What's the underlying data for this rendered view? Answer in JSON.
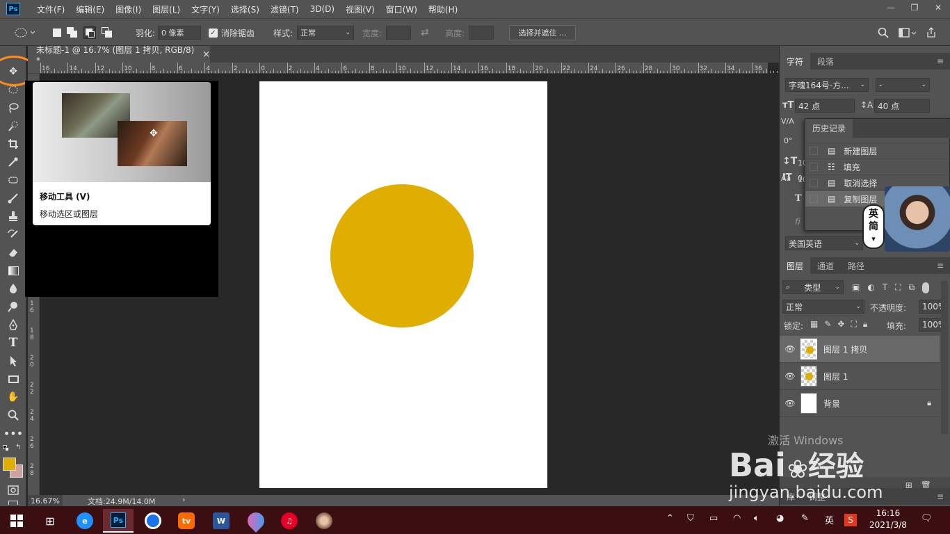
{
  "menu": {
    "items": [
      "文件(F)",
      "编辑(E)",
      "图像(I)",
      "图层(L)",
      "文字(Y)",
      "选择(S)",
      "滤镜(T)",
      "3D(D)",
      "视图(V)",
      "窗口(W)",
      "帮助(H)"
    ]
  },
  "app_logo": "Ps",
  "window_controls": {
    "minimize": "—",
    "restore": "❐",
    "close": "✕"
  },
  "options": {
    "feather_label": "羽化:",
    "feather_value": "0 像素",
    "antialias_label": "消除锯齿",
    "style_label": "样式:",
    "style_value": "正常",
    "width_label": "宽度:",
    "height_label": "高度:",
    "select_mask_button": "选择并遮住 ..."
  },
  "document_tab": {
    "title": "未标题-1 @ 16.7% (图层 1 拷贝, RGB/8) *",
    "close": "×"
  },
  "ruler": {
    "ticks": [
      "16",
      "14",
      "12",
      "10",
      "8",
      "6",
      "4",
      "2",
      "0",
      "2",
      "4",
      "6",
      "8",
      "10",
      "12",
      "14",
      "16",
      "18",
      "20",
      "22",
      "24",
      "26",
      "28",
      "30",
      "32",
      "34",
      "36"
    ],
    "vticks": [
      "1\n6",
      "1\n8",
      "2\n0",
      "2\n2",
      "2\n4",
      "2\n6",
      "2\n8"
    ]
  },
  "tooltip": {
    "title": "移动工具 (V)",
    "description": "移动选区或图层"
  },
  "status": {
    "zoom": "16.67%",
    "doc_info": "文档:24.9M/14.0M",
    "arrow": "›"
  },
  "character_panel": {
    "tabs": [
      "字符",
      "段落"
    ],
    "font_family": "字魂164号-方...",
    "font_style": "-",
    "font_size": "42 点",
    "leading": "40 点",
    "row_labels": [
      "V/A",
      "0°",
      "10",
      "10",
      "0"
    ],
    "language": "美国英语"
  },
  "history_panel": {
    "title": "历史记录",
    "items": [
      "新建图层",
      "填充",
      "取消选择",
      "复制图层"
    ]
  },
  "ime_badge": {
    "line1": "英",
    "line2": "简"
  },
  "layers_panel": {
    "tabs": [
      "图层",
      "通道",
      "路径"
    ],
    "filter_kind": "类型",
    "blend_mode": "正常",
    "opacity_label": "不透明度:",
    "opacity_value": "100%",
    "lock_label": "锁定:",
    "fill_label": "填充:",
    "fill_value": "100%",
    "layers": [
      {
        "name": "图层 1 拷贝",
        "selected": true
      },
      {
        "name": "图层 1",
        "selected": false
      },
      {
        "name": "背景",
        "selected": false,
        "locked": true
      }
    ],
    "bottom_tabs": [
      "库",
      "调整"
    ]
  },
  "taskbar": {
    "time": "16:16",
    "date": "2021/3/8",
    "ime": "英"
  },
  "watermark": {
    "activate": "激活 Windows",
    "brand": "Bai",
    "brand_cn": "经验",
    "url": "jingyan.baidu.com"
  },
  "colors": {
    "foreground": "#e0ae00",
    "background": "#cfa1a1",
    "circle": "#e0ae00",
    "highlight_ring": "#ff8c1a"
  }
}
